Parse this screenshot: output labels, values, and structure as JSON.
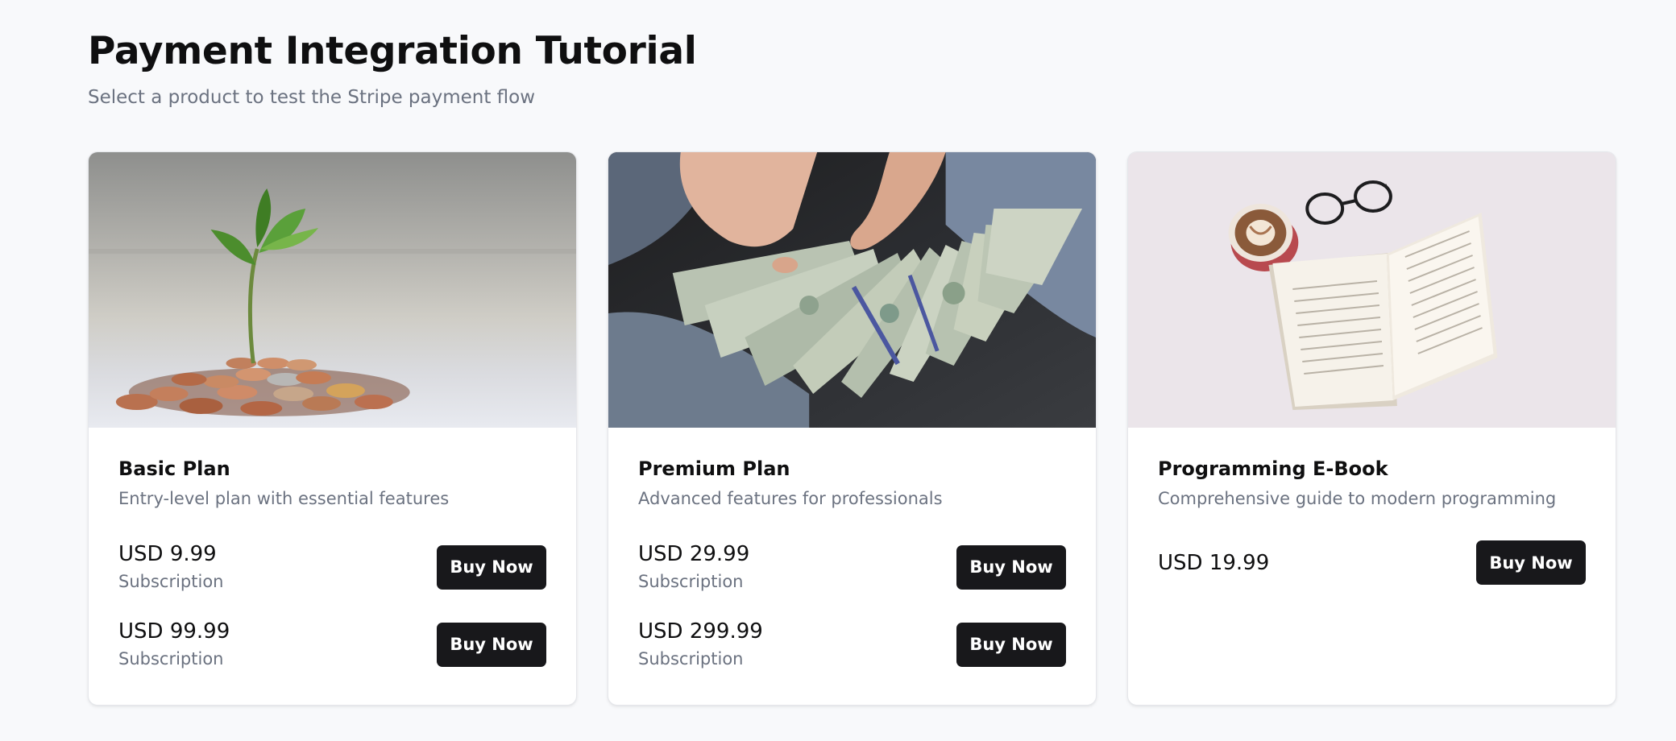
{
  "header": {
    "title": "Payment Integration Tutorial",
    "subtitle": "Select a product to test the Stripe payment flow"
  },
  "products": [
    {
      "title": "Basic Plan",
      "description": "Entry-level plan with essential features",
      "image_icon": "plant-in-coins-photo",
      "prices": [
        {
          "amount": "USD 9.99",
          "period": "Subscription",
          "button": "Buy Now"
        },
        {
          "amount": "USD 99.99",
          "period": "Subscription",
          "button": "Buy Now"
        }
      ]
    },
    {
      "title": "Premium Plan",
      "description": "Advanced features for professionals",
      "image_icon": "hands-holding-dollar-bills-photo",
      "prices": [
        {
          "amount": "USD 29.99",
          "period": "Subscription",
          "button": "Buy Now"
        },
        {
          "amount": "USD 299.99",
          "period": "Subscription",
          "button": "Buy Now"
        }
      ]
    },
    {
      "title": "Programming E-Book",
      "description": "Comprehensive guide to modern programming",
      "image_icon": "open-book-coffee-glasses-photo",
      "prices": [
        {
          "amount": "USD 19.99",
          "period": "",
          "button": "Buy Now"
        }
      ]
    }
  ],
  "colors": {
    "background": "#f8f9fb",
    "button": "#18181b",
    "muted_text": "#6b7280"
  }
}
